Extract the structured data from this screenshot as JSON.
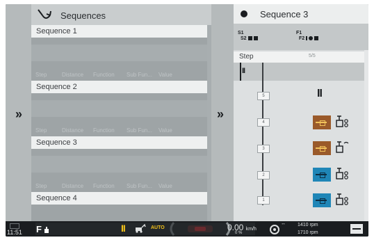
{
  "left_panel": {
    "title": "Sequences",
    "sequences": [
      {
        "name": "Sequence 1",
        "columns": [
          "Step",
          "Distance",
          "Function",
          "Sub Fun...",
          "Value"
        ]
      },
      {
        "name": "Sequence 2",
        "columns": [
          "Step",
          "Distance",
          "Function",
          "Sub Fun...",
          "Value"
        ]
      },
      {
        "name": "Sequence 3",
        "columns": [
          "Step",
          "Distance",
          "Function",
          "Sub Fun...",
          "Value"
        ]
      },
      {
        "name": "Sequence 4",
        "columns": []
      }
    ],
    "expand_glyph": "»"
  },
  "right_panel": {
    "title": "Sequence 3",
    "expand_glyph": "»",
    "switches": [
      {
        "label": "S1"
      },
      {
        "label": "S2"
      },
      {
        "label": "F1"
      },
      {
        "label": "F2"
      }
    ],
    "step_label": "Step",
    "step_count": "5/5",
    "pause_glyph": "II",
    "steps": [
      {
        "number": "5",
        "action": "pause",
        "pause_glyph": "II"
      },
      {
        "number": "4",
        "action": "hydraulic",
        "color": "#9a5a2a",
        "sub_icon": "valve-icon"
      },
      {
        "number": "3",
        "action": "hydraulic",
        "color": "#9a5a2a",
        "sub_icon": "valve-float-icon"
      },
      {
        "number": "2",
        "action": "hydraulic",
        "color": "#1f86b7",
        "sub_icon": "valve-icon"
      },
      {
        "number": "1",
        "action": "hydraulic",
        "color": "#1f86b7",
        "sub_icon": "valve-icon"
      }
    ]
  },
  "status_bar": {
    "time": "11:51",
    "f_label": "F",
    "auto_label": "AUTO",
    "speed": "0.00",
    "speed_unit": "km/h",
    "slip": "0 %",
    "rpm_1": "1410 rpm",
    "rpm_2": "1710 rpm",
    "pause_glyph": "II"
  },
  "colors": {
    "accent_yellow": "#f4c21a",
    "brown_valve": "#9a5a2a",
    "blue_valve": "#1f86b7"
  }
}
